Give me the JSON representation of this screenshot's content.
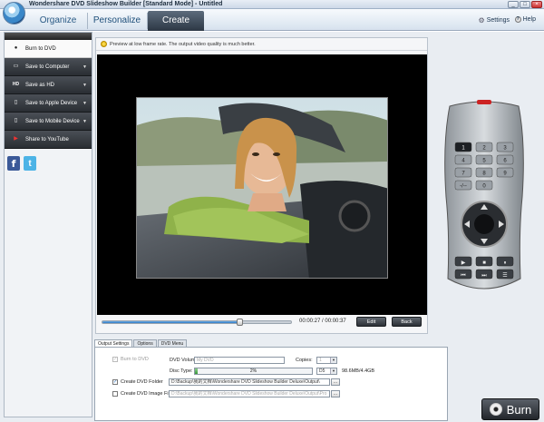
{
  "window": {
    "title": "Wondershare DVD Slideshow Builder [Standard Mode] - Untitled",
    "controls": [
      "_",
      "□",
      "×"
    ]
  },
  "nav": {
    "tabs": [
      {
        "label": "Organize"
      },
      {
        "label": "Personalize"
      },
      {
        "label": "Create",
        "active": true
      }
    ],
    "settings_label": "Settings",
    "help_label": "Help",
    "help_glyph": "?"
  },
  "sidebar": {
    "items": [
      {
        "label": "Burn to DVD",
        "icon": "disc-icon",
        "active": true,
        "glyph": "●"
      },
      {
        "label": "Save to Computer",
        "icon": "monitor-icon",
        "glyph": "▭"
      },
      {
        "label": "Save as HD",
        "icon": "hd-icon",
        "glyph": "HD"
      },
      {
        "label": "Save to Apple Device",
        "icon": "apple-device-icon",
        "glyph": "▯"
      },
      {
        "label": "Save to Mobile Device",
        "icon": "mobile-icon",
        "glyph": "▯"
      },
      {
        "label": "Share to YouTube",
        "icon": "youtube-icon",
        "glyph": "▶"
      }
    ],
    "social": [
      {
        "name": "facebook",
        "glyph": "f"
      },
      {
        "name": "twitter",
        "glyph": "t"
      }
    ]
  },
  "preview": {
    "tip": "Preview at low frame rate. The output video quality is much better.",
    "time_current": "00:00:27",
    "time_total": "00:00:37",
    "progress": 0.73,
    "edit_label": "Edit",
    "back_label": "Back"
  },
  "remote": {
    "keys": [
      "1",
      "2",
      "3",
      "4",
      "5",
      "6",
      "7",
      "8",
      "9",
      "-/--",
      "0"
    ]
  },
  "output": {
    "tabs": [
      {
        "label": "Output Settings",
        "active": true
      },
      {
        "label": "Options"
      },
      {
        "label": "DVD Menu"
      }
    ],
    "burn_to_dvd_label": "Burn to DVD",
    "dvd_volume_label": "DVD Volume:",
    "dvd_volume_value": "My DVD",
    "copies_label": "Copies:",
    "copies_value": "1",
    "disc_type_label": "Disc Type:",
    "disc_percent": "2%",
    "disc_fill": 0.02,
    "disc_type_value": "D5",
    "disc_size": "98.6MB/4.4GB",
    "create_folder_label": "Create DVD Folder",
    "folder_path": "D:\\Backup\\我的文档\\Wondershare DVD Slideshow Builder Deluxe\\Output\\",
    "create_image_label": "Create DVD Image File",
    "image_path": "D:\\Backup\\我的文档\\Wondershare DVD Slideshow Builder Deluxe\\Output\\Pro",
    "browse_label": "..."
  },
  "burn": {
    "label": "Burn"
  },
  "colors": {
    "accent": "#2f78c2",
    "nav_active": "#2c3744",
    "sidebar_dark": "#2a2e33"
  }
}
